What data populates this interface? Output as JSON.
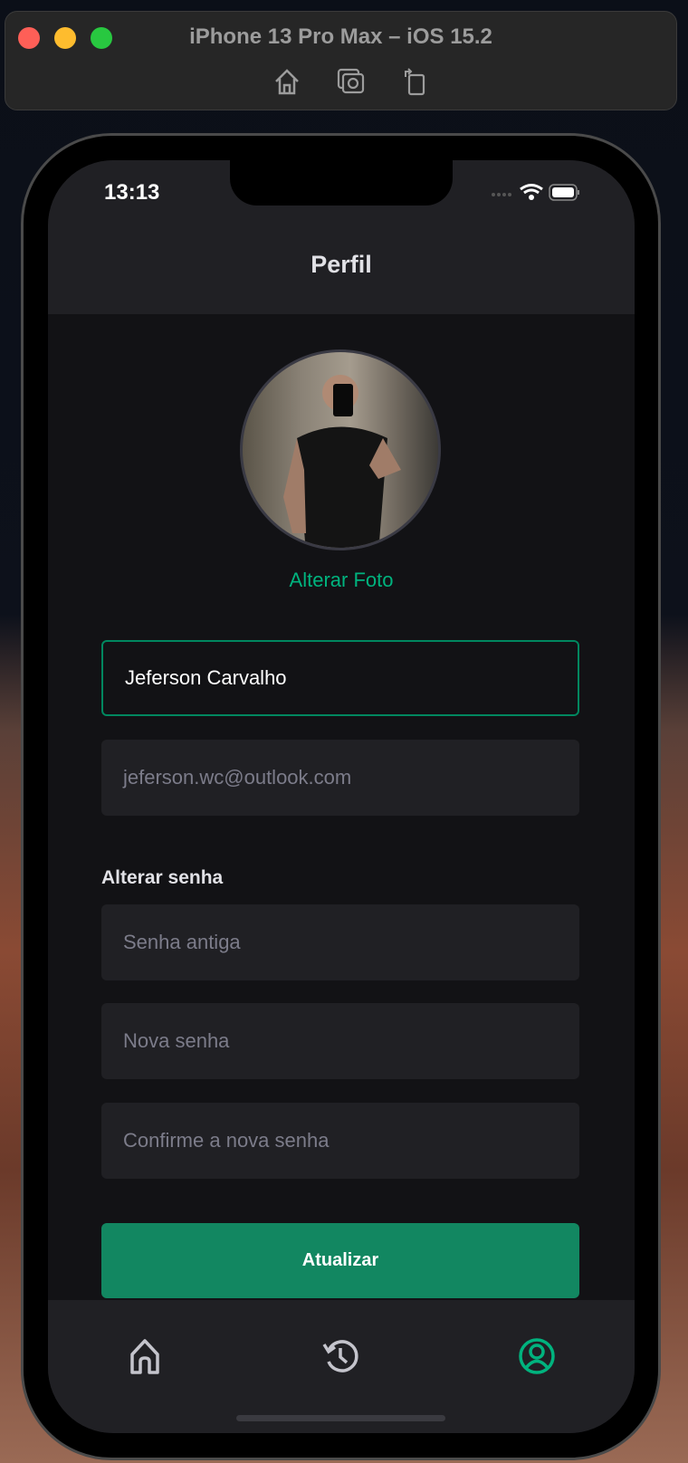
{
  "window": {
    "title": "iPhone 13 Pro Max – iOS 15.2",
    "controls": [
      "close",
      "minimize",
      "zoom"
    ],
    "toolbar": [
      "home-icon",
      "screenshot-icon",
      "rotate-icon"
    ]
  },
  "status_bar": {
    "time": "13:13"
  },
  "header": {
    "title": "Perfil"
  },
  "profile": {
    "change_photo": "Alterar Foto"
  },
  "form": {
    "name_value": "Jeferson Carvalho",
    "email_value": "jeferson.wc@outlook.com",
    "password_section": "Alterar senha",
    "old_password_placeholder": "Senha antiga",
    "new_password_placeholder": "Nova senha",
    "confirm_password_placeholder": "Confirme a nova senha",
    "submit": "Atualizar"
  },
  "tabs": [
    {
      "icon": "home-icon",
      "active": false
    },
    {
      "icon": "history-icon",
      "active": false
    },
    {
      "icon": "profile-icon",
      "active": true
    }
  ],
  "colors": {
    "accent": "#00b37e",
    "button": "#128761",
    "background": "#121215",
    "surface": "#202024"
  }
}
